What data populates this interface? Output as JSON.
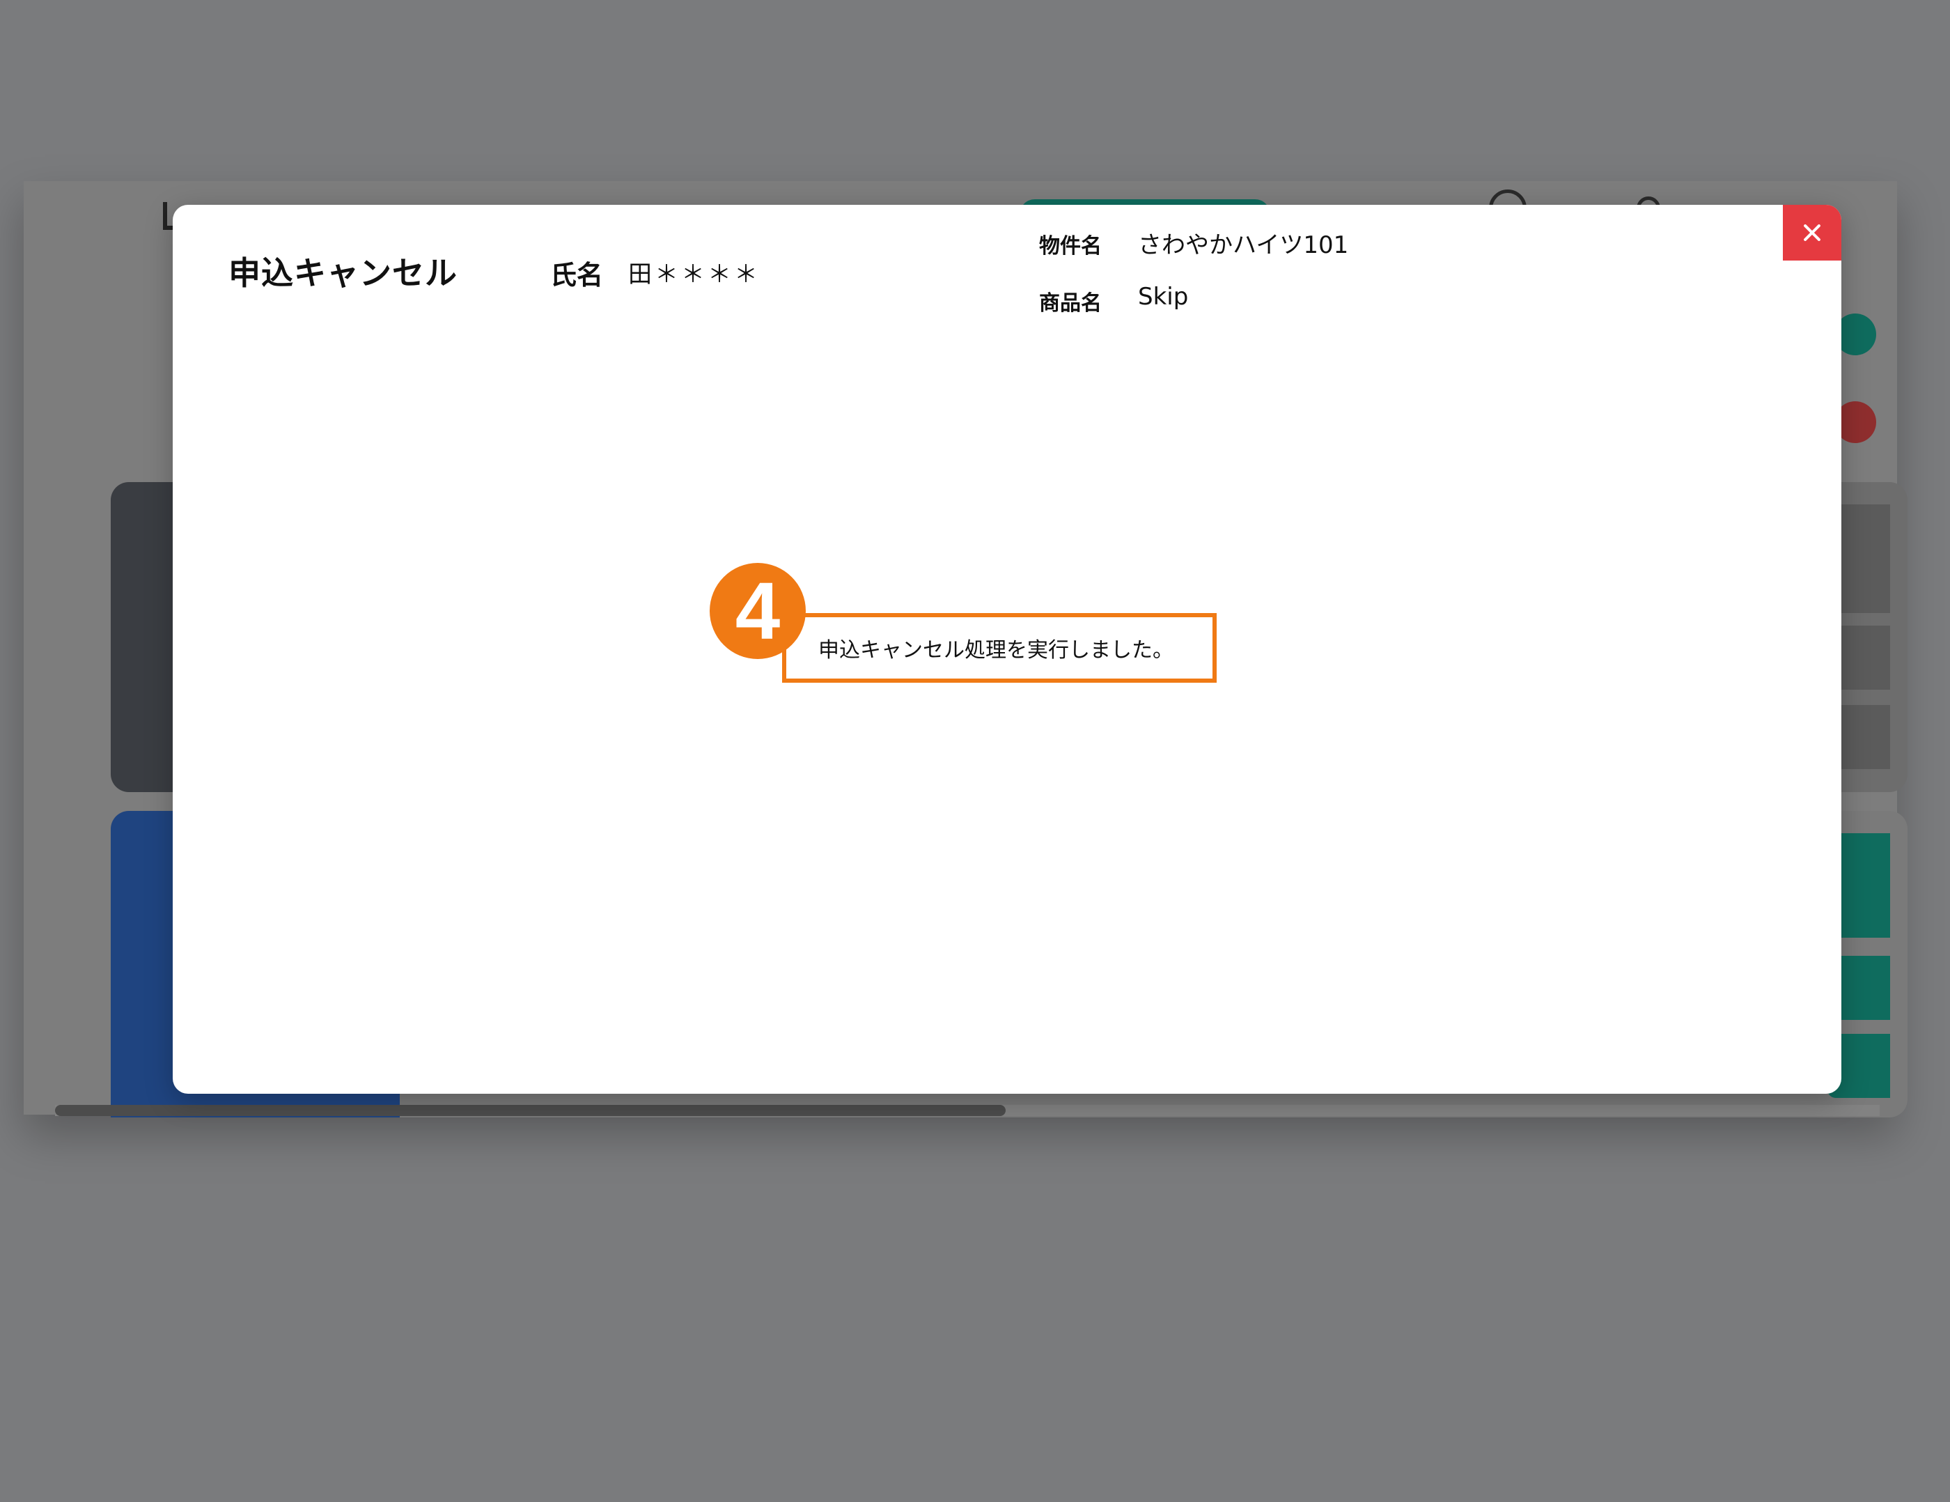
{
  "modal": {
    "title": "申込キャンセル",
    "name_label": "氏名",
    "name_value": "田＊＊＊＊",
    "property_label": "物件名",
    "property_value": "さわやかハイツ101",
    "product_label": "商品名",
    "product_value": "Skip",
    "close_icon": "close-icon",
    "close_color": "#e53a40",
    "message": "申込キャンセル処理を実行しました。",
    "step_badge": "4",
    "highlight_color": "#f07a14"
  }
}
